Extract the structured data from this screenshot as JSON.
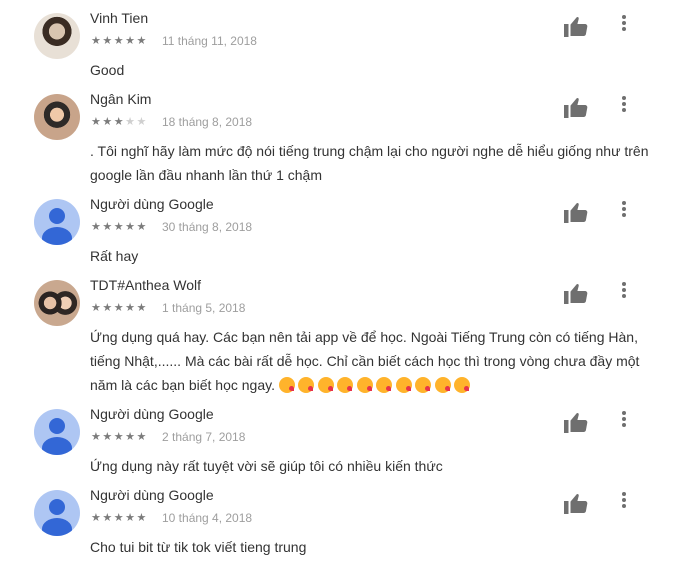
{
  "reviews": [
    {
      "name": "Vinh Tien",
      "rating": 5,
      "date": "11 tháng 11, 2018",
      "text": "Good",
      "avatar": "photo1",
      "emojis": 0
    },
    {
      "name": "Ngân Kim",
      "rating": 3,
      "date": "18 tháng 8, 2018",
      "text": ". Tôi nghĩ hãy làm mức độ nói tiếng trung chậm lại cho người nghe dễ hiểu giống như trên google lần đầu nhanh lần thứ 1 chậm",
      "avatar": "photo2",
      "emojis": 0
    },
    {
      "name": "Người dùng Google",
      "rating": 5,
      "date": "30 tháng 8, 2018",
      "text": "Rất hay",
      "avatar": "default",
      "emojis": 0
    },
    {
      "name": "TDT#Anthea Wolf",
      "rating": 5,
      "date": "1 tháng 5, 2018",
      "text": "Ứng dụng quá hay. Các bạn nên tải app về để học. Ngoài Tiếng Trung còn có tiếng Hàn, tiếng Nhật,...... Mà các bài rất dễ học. Chỉ cần biết cách học thì trong vòng chưa đầy một năm là các bạn biết học ngay.",
      "avatar": "photo3",
      "emojis": 10
    },
    {
      "name": "Người dùng Google",
      "rating": 5,
      "date": "2 tháng 7, 2018",
      "text": "Ứng dụng này rất tuyệt vời sẽ giúp tôi có nhiều kiến thức",
      "avatar": "default",
      "emojis": 0
    },
    {
      "name": "Người dùng Google",
      "rating": 5,
      "date": "10 tháng 4, 2018",
      "text": "Cho tui bit từ tik tok viết tieng trung",
      "avatar": "default",
      "emojis": 0
    }
  ],
  "icons": {
    "helpful": "thumbs-up-icon",
    "menu": "more-vert-icon",
    "emoji": "face-throwing-kiss-emoji"
  },
  "colors": {
    "icon": "#6f6f6f",
    "star_on": "#7b7b7b",
    "star_off": "#cfcfcf",
    "avatar_default": "#3367d6"
  }
}
